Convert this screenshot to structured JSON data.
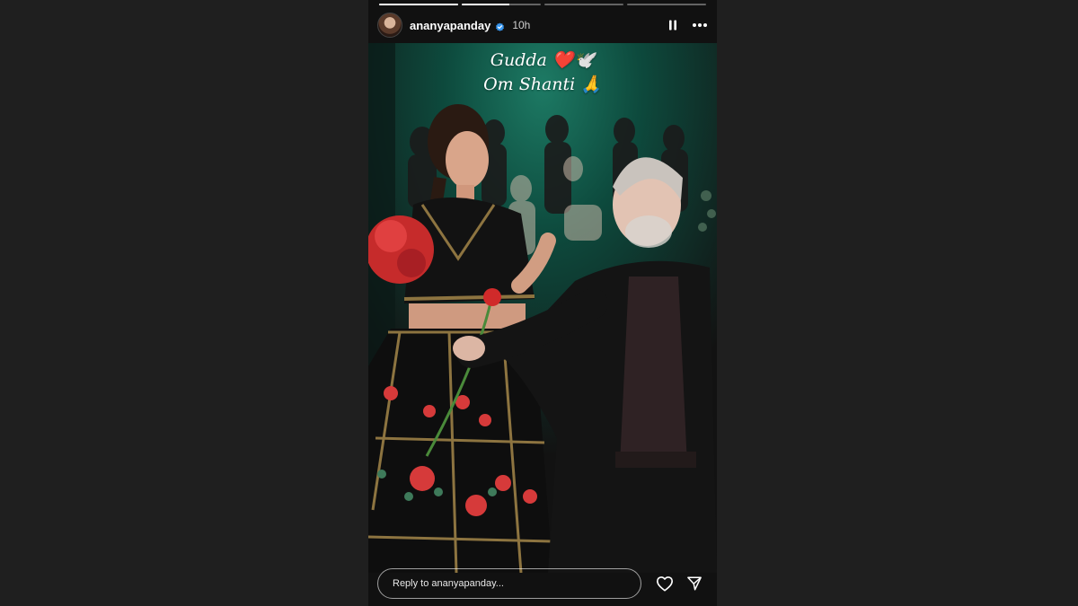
{
  "story": {
    "username": "ananyapanday",
    "time_ago": "10h",
    "progress": [
      1,
      0.6,
      0,
      0
    ],
    "caption_line1": "Gudda ❤️🕊️",
    "caption_line2": "Om Shanti 🙏"
  },
  "reply": {
    "placeholder": "Reply to ananyapanday..."
  },
  "icons": {
    "pause": "pause-icon",
    "more": "more-options-icon",
    "verified": "verified-badge-icon",
    "like": "heart-icon",
    "share": "send-icon"
  },
  "colors": {
    "page_background": "#1f1f1f",
    "verified_blue": "#3897f0",
    "backdrop_green": "#0f5a4a"
  }
}
